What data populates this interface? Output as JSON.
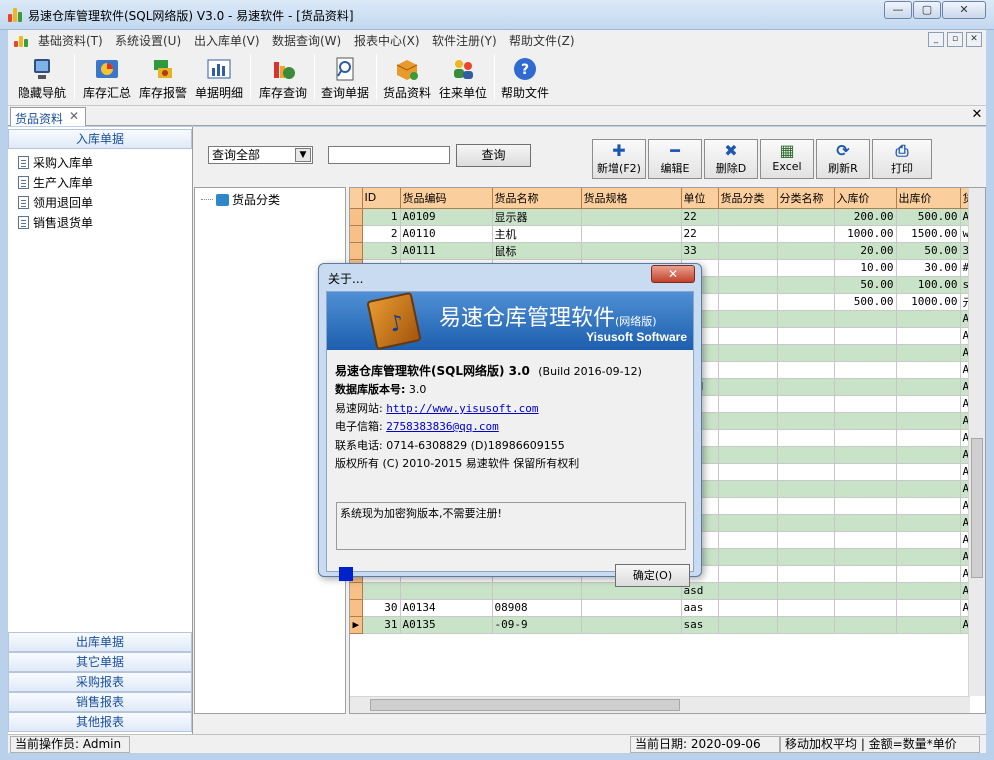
{
  "window": {
    "title": "易速仓库管理软件(SQL网络版) V3.0 - 易速软件 - [货品资料]",
    "controls": [
      "minimize",
      "maximize",
      "close"
    ]
  },
  "menu": [
    "基础资料(T)",
    "系统设置(U)",
    "出入库单(V)",
    "数据查询(W)",
    "报表中心(X)",
    "软件注册(Y)",
    "帮助文件(Z)"
  ],
  "toolbar": [
    {
      "label": "隐藏导航",
      "icon": "monitor-icon"
    },
    {
      "label": "库存汇总",
      "icon": "chart-pie-icon"
    },
    {
      "label": "库存报警",
      "icon": "alarm-icon"
    },
    {
      "label": "单据明细",
      "icon": "bar-chart-icon"
    },
    {
      "label": "库存查询",
      "icon": "stock-icon"
    },
    {
      "label": "查询单据",
      "icon": "search-doc-icon"
    },
    {
      "label": "货品资料",
      "icon": "box-icon"
    },
    {
      "label": "往来单位",
      "icon": "people-icon"
    },
    {
      "label": "帮助文件",
      "icon": "help-icon"
    }
  ],
  "tab": {
    "label": "货品资料"
  },
  "nav": {
    "inbound_header": "入库单据",
    "inbound_items": [
      "采购入库单",
      "生产入库单",
      "领用退回单",
      "销售退货单"
    ],
    "bottom_headers": [
      "出库单据",
      "其它单据",
      "采购报表",
      "销售报表",
      "其他报表"
    ]
  },
  "filter": {
    "select_value": "查询全部",
    "query_button": "查询",
    "actions": [
      {
        "label": "新增(F2)",
        "icon": "plus-icon"
      },
      {
        "label": "编辑E",
        "icon": "minus-icon"
      },
      {
        "label": "删除D",
        "icon": "delete-icon"
      },
      {
        "label": "Excel",
        "icon": "excel-icon"
      },
      {
        "label": "刷新R",
        "icon": "refresh-icon"
      },
      {
        "label": "打印",
        "icon": "print-icon"
      }
    ]
  },
  "tree": {
    "root": "货品分类"
  },
  "grid": {
    "columns": [
      "ID",
      "货品编码",
      "货品名称",
      "货品规格",
      "单位",
      "货品分类",
      "分类名称",
      "入库价",
      "出库价",
      "货"
    ],
    "rows": [
      [
        "1",
        "A0109",
        "显示器",
        "",
        "22",
        "",
        "",
        "200.00",
        "500.00",
        "A"
      ],
      [
        "2",
        "A0110",
        "主机",
        "",
        "22",
        "",
        "",
        "1000.00",
        "1500.00",
        "w"
      ],
      [
        "3",
        "A0111",
        "鼠标",
        "",
        "33",
        "",
        "",
        "20.00",
        "50.00",
        "3"
      ],
      [
        "",
        "",
        "",
        "",
        "",
        "",
        "",
        "10.00",
        "30.00",
        "#"
      ],
      [
        "",
        "",
        "",
        "",
        "",
        "",
        "",
        "50.00",
        "100.00",
        "s"
      ],
      [
        "",
        "",
        "",
        "",
        "",
        "",
        "",
        "500.00",
        "1000.00",
        "元"
      ],
      [
        "",
        "",
        "",
        "",
        "",
        "",
        "",
        "",
        "",
        "A"
      ],
      [
        "",
        "",
        "",
        "",
        "",
        "",
        "",
        "",
        "",
        "A"
      ],
      [
        "",
        "",
        "",
        "",
        "",
        "",
        "",
        "",
        "",
        "A"
      ],
      [
        "",
        "",
        "",
        "",
        "",
        "",
        "",
        "",
        "",
        "A"
      ],
      [
        "",
        "",
        "",
        "",
        "asd",
        "",
        "",
        "",
        "",
        "A"
      ],
      [
        "",
        "",
        "",
        "",
        "",
        "",
        "",
        "",
        "",
        "A"
      ],
      [
        "",
        "",
        "",
        "",
        "",
        "",
        "",
        "",
        "",
        "A"
      ],
      [
        "",
        "",
        "",
        "",
        "",
        "",
        "",
        "",
        "",
        "A"
      ],
      [
        "",
        "",
        "",
        "",
        "",
        "",
        "",
        "",
        "",
        "A"
      ],
      [
        "",
        "",
        "",
        "",
        "",
        "",
        "",
        "",
        "",
        "A"
      ],
      [
        "",
        "",
        "",
        "",
        "z",
        "",
        "",
        "",
        "",
        "A"
      ],
      [
        "",
        "",
        "",
        "",
        "",
        "",
        "",
        "",
        "",
        "A"
      ],
      [
        "",
        "",
        "",
        "",
        "",
        "",
        "",
        "",
        "",
        "A"
      ],
      [
        "",
        "",
        "",
        "",
        "",
        "",
        "",
        "",
        "",
        "A"
      ],
      [
        "",
        "",
        "",
        "",
        "",
        "",
        "",
        "",
        "",
        "A"
      ],
      [
        "",
        "",
        "",
        "",
        "",
        "",
        "",
        "",
        "",
        "A"
      ],
      [
        "",
        "",
        "",
        "",
        "asd",
        "",
        "",
        "",
        "",
        "A"
      ],
      [
        "30",
        "A0134",
        "08908",
        "",
        "aas",
        "",
        "",
        "",
        "",
        "A"
      ],
      [
        "31",
        "A0135",
        "-09-9",
        "",
        "sas",
        "",
        "",
        "",
        "",
        "A"
      ]
    ]
  },
  "status": {
    "operator": "当前操作员: Admin",
    "date": "当前日期: 2020-09-06",
    "method": "移动加权平均 | 金额=数量*单价"
  },
  "about": {
    "title": "关于...",
    "product_banner": "易速仓库管理软件",
    "product_edition": "(网络版)",
    "company_en": "Yisusoft Software",
    "version_line": "易速仓库管理软件(SQL网络版) 3.0",
    "build": "(Build 2016-09-12)",
    "db_label": "数据库版本号:",
    "db_version": "3.0",
    "site_label": "易速网站:",
    "site_url": "http://www.yisusoft.com",
    "email_label": "电子信箱:",
    "email": "2758383836@qq.com",
    "phone": "联系电话: 0714-6308829 (D)18986609155",
    "copyright": "版权所有 (C) 2010-2015 易速软件 保留所有权利",
    "notice": "系统现为加密狗版本,不需要注册!",
    "ok_button": "确定(O)"
  }
}
